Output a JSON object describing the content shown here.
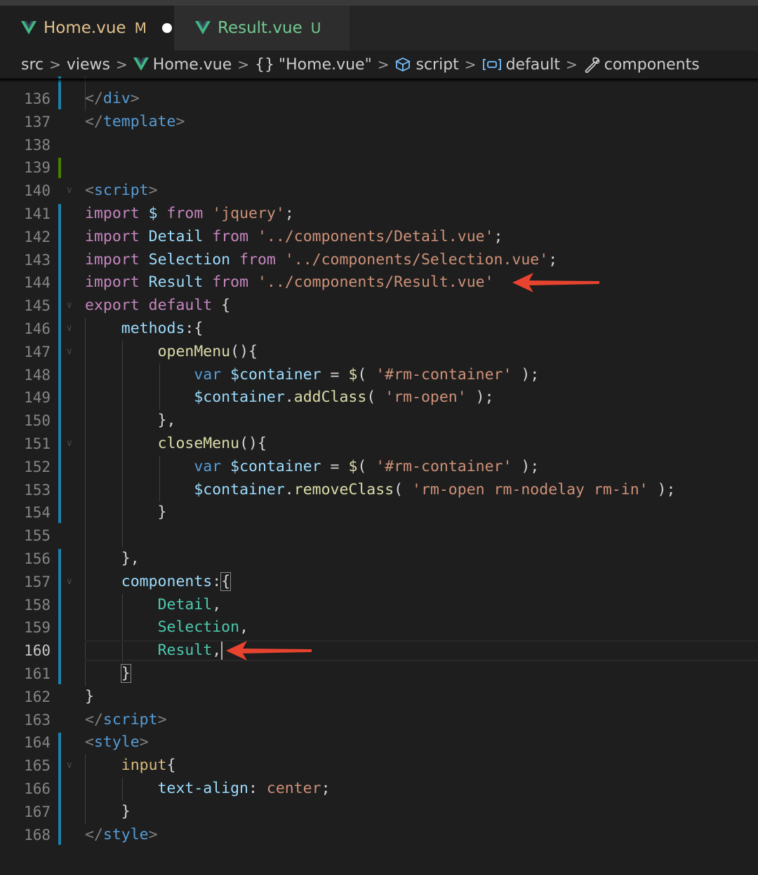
{
  "tabs": [
    {
      "name": "Home.vue",
      "status": "M",
      "active": true,
      "dirty": true
    },
    {
      "name": "Result.vue",
      "status": "U",
      "active": false,
      "dirty": false
    }
  ],
  "breadcrumb": [
    "src",
    "views",
    "Home.vue",
    "\"Home.vue\"",
    "script",
    "default",
    "components"
  ],
  "current_line": 160,
  "code_lines": [
    {
      "n": 136,
      "tokens": [
        [
          "t-punc",
          "</"
        ],
        [
          "t-tag",
          "div"
        ],
        [
          "t-punc",
          ">"
        ]
      ]
    },
    {
      "n": 137,
      "tokens": [
        [
          "t-punc",
          "</"
        ],
        [
          "t-tag",
          "template"
        ],
        [
          "t-punc",
          ">"
        ]
      ]
    },
    {
      "n": 138,
      "tokens": []
    },
    {
      "n": 139,
      "tokens": []
    },
    {
      "n": 140,
      "tokens": [
        [
          "t-punc",
          "<"
        ],
        [
          "t-tag",
          "script"
        ],
        [
          "t-punc",
          ">"
        ]
      ]
    },
    {
      "n": 141,
      "tokens": [
        [
          "t-kw",
          "import"
        ],
        [
          "t-plain",
          " "
        ],
        [
          "t-var",
          "$"
        ],
        [
          "t-plain",
          " "
        ],
        [
          "t-kw",
          "from"
        ],
        [
          "t-plain",
          " "
        ],
        [
          "t-str",
          "'jquery'"
        ],
        [
          "t-plain",
          ";"
        ]
      ]
    },
    {
      "n": 142,
      "tokens": [
        [
          "t-kw",
          "import"
        ],
        [
          "t-plain",
          " "
        ],
        [
          "t-var",
          "Detail"
        ],
        [
          "t-plain",
          " "
        ],
        [
          "t-kw",
          "from"
        ],
        [
          "t-plain",
          " "
        ],
        [
          "t-str",
          "'../components/Detail.vue'"
        ],
        [
          "t-plain",
          ";"
        ]
      ]
    },
    {
      "n": 143,
      "tokens": [
        [
          "t-kw",
          "import"
        ],
        [
          "t-plain",
          " "
        ],
        [
          "t-var",
          "Selection"
        ],
        [
          "t-plain",
          " "
        ],
        [
          "t-kw",
          "from"
        ],
        [
          "t-plain",
          " "
        ],
        [
          "t-str",
          "'../components/Selection.vue'"
        ],
        [
          "t-plain",
          ";"
        ]
      ]
    },
    {
      "n": 144,
      "tokens": [
        [
          "t-kw",
          "import"
        ],
        [
          "t-plain",
          " "
        ],
        [
          "t-var",
          "Result"
        ],
        [
          "t-plain",
          " "
        ],
        [
          "t-kw",
          "from"
        ],
        [
          "t-plain",
          " "
        ],
        [
          "t-str",
          "'../components/Result.vue'"
        ]
      ]
    },
    {
      "n": 145,
      "tokens": [
        [
          "t-kw",
          "export"
        ],
        [
          "t-plain",
          " "
        ],
        [
          "t-kw",
          "default"
        ],
        [
          "t-plain",
          " {"
        ]
      ]
    },
    {
      "n": 146,
      "tokens": [
        [
          "t-plain",
          "    "
        ],
        [
          "t-var",
          "methods"
        ],
        [
          "t-plain",
          ":{"
        ]
      ]
    },
    {
      "n": 147,
      "tokens": [
        [
          "t-plain",
          "        "
        ],
        [
          "t-fn",
          "openMenu"
        ],
        [
          "t-plain",
          "(){"
        ]
      ]
    },
    {
      "n": 148,
      "tokens": [
        [
          "t-plain",
          "            "
        ],
        [
          "t-stkw",
          "var"
        ],
        [
          "t-plain",
          " "
        ],
        [
          "t-var",
          "$container"
        ],
        [
          "t-plain",
          " = "
        ],
        [
          "t-fn",
          "$"
        ],
        [
          "t-plain",
          "( "
        ],
        [
          "t-str",
          "'#rm-container'"
        ],
        [
          "t-plain",
          " );"
        ]
      ]
    },
    {
      "n": 149,
      "tokens": [
        [
          "t-plain",
          "            "
        ],
        [
          "t-var",
          "$container"
        ],
        [
          "t-plain",
          "."
        ],
        [
          "t-fn",
          "addClass"
        ],
        [
          "t-plain",
          "( "
        ],
        [
          "t-str",
          "'rm-open'"
        ],
        [
          "t-plain",
          " );"
        ]
      ]
    },
    {
      "n": 150,
      "tokens": [
        [
          "t-plain",
          "        },"
        ]
      ]
    },
    {
      "n": 151,
      "tokens": [
        [
          "t-plain",
          "        "
        ],
        [
          "t-fn",
          "closeMenu"
        ],
        [
          "t-plain",
          "(){"
        ]
      ]
    },
    {
      "n": 152,
      "tokens": [
        [
          "t-plain",
          "            "
        ],
        [
          "t-stkw",
          "var"
        ],
        [
          "t-plain",
          " "
        ],
        [
          "t-var",
          "$container"
        ],
        [
          "t-plain",
          " = "
        ],
        [
          "t-fn",
          "$"
        ],
        [
          "t-plain",
          "( "
        ],
        [
          "t-str",
          "'#rm-container'"
        ],
        [
          "t-plain",
          " );"
        ]
      ]
    },
    {
      "n": 153,
      "tokens": [
        [
          "t-plain",
          "            "
        ],
        [
          "t-var",
          "$container"
        ],
        [
          "t-plain",
          "."
        ],
        [
          "t-fn",
          "removeClass"
        ],
        [
          "t-plain",
          "( "
        ],
        [
          "t-str",
          "'rm-open rm-nodelay rm-in'"
        ],
        [
          "t-plain",
          " );"
        ]
      ]
    },
    {
      "n": 154,
      "tokens": [
        [
          "t-plain",
          "        }"
        ]
      ]
    },
    {
      "n": 155,
      "tokens": []
    },
    {
      "n": 156,
      "tokens": [
        [
          "t-plain",
          "    },"
        ]
      ]
    },
    {
      "n": 157,
      "tokens": [
        [
          "t-plain",
          "    "
        ],
        [
          "t-var",
          "components"
        ],
        [
          "t-plain",
          ":"
        ],
        [
          "t-plain bracket-match",
          "{"
        ]
      ]
    },
    {
      "n": 158,
      "tokens": [
        [
          "t-plain",
          "        "
        ],
        [
          "t-ty",
          "Detail"
        ],
        [
          "t-plain",
          ","
        ]
      ]
    },
    {
      "n": 159,
      "tokens": [
        [
          "t-plain",
          "        "
        ],
        [
          "t-ty",
          "Selection"
        ],
        [
          "t-plain",
          ","
        ]
      ]
    },
    {
      "n": 160,
      "tokens": [
        [
          "t-plain",
          "        "
        ],
        [
          "t-ty",
          "Result"
        ],
        [
          "t-plain",
          ","
        ]
      ]
    },
    {
      "n": 161,
      "tokens": [
        [
          "t-plain",
          "    "
        ],
        [
          "t-plain bracket-match",
          "}"
        ]
      ]
    },
    {
      "n": 162,
      "tokens": [
        [
          "t-plain",
          "}"
        ]
      ]
    },
    {
      "n": 163,
      "tokens": [
        [
          "t-punc",
          "</"
        ],
        [
          "t-tag",
          "script"
        ],
        [
          "t-punc",
          ">"
        ]
      ]
    },
    {
      "n": 164,
      "tokens": [
        [
          "t-punc",
          "<"
        ],
        [
          "t-tag",
          "style"
        ],
        [
          "t-punc",
          ">"
        ]
      ]
    },
    {
      "n": 165,
      "tokens": [
        [
          "t-plain",
          "    "
        ],
        [
          "t-sel",
          "input"
        ],
        [
          "t-plain",
          "{"
        ]
      ]
    },
    {
      "n": 166,
      "tokens": [
        [
          "t-plain",
          "        "
        ],
        [
          "t-prop",
          "text-align"
        ],
        [
          "t-plain",
          ": "
        ],
        [
          "t-str",
          "center"
        ],
        [
          "t-plain",
          ";"
        ]
      ]
    },
    {
      "n": 167,
      "tokens": [
        [
          "t-plain",
          "    }"
        ]
      ]
    },
    {
      "n": 168,
      "tokens": [
        [
          "t-punc",
          "</"
        ],
        [
          "t-tag",
          "style"
        ],
        [
          "t-punc",
          ">"
        ]
      ]
    }
  ],
  "colors": {
    "editor_bg": "#1e1e1e",
    "tab_bar_bg": "#252526",
    "modified": "#e2c08d",
    "untracked": "#73c991",
    "git_modified_bar": "#1b81a8",
    "git_added_bar": "#487e02",
    "annotation_arrow": "#e8432f"
  }
}
